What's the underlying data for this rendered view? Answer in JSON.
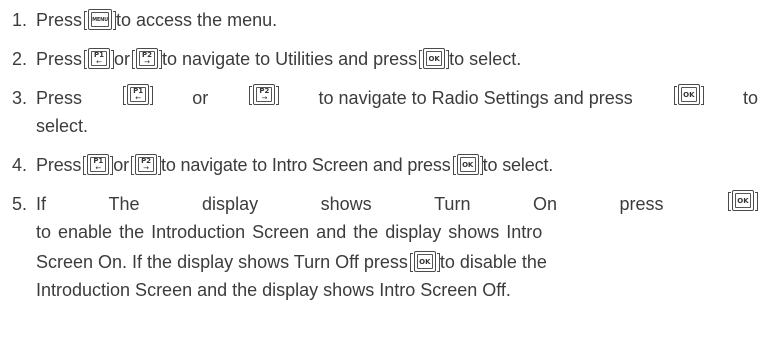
{
  "steps": [
    {
      "number": "1.",
      "lines": [
        [
          "Press",
          {
            "key": "MENU"
          },
          "to access the menu."
        ]
      ]
    },
    {
      "number": "2.",
      "lines": [
        [
          "Press",
          {
            "key": "P1"
          },
          "or",
          {
            "key": "P2"
          },
          "to navigate to Utilities and press",
          {
            "key": "OK"
          },
          "to select."
        ]
      ]
    },
    {
      "number": "3.",
      "lines": [
        [
          "Press",
          {
            "key": "P1"
          },
          "or",
          {
            "key": "P2"
          },
          "to navigate to Radio Settings and press",
          {
            "key": "OK"
          },
          "to"
        ],
        [
          "select."
        ]
      ]
    },
    {
      "number": "4.",
      "lines": [
        [
          "Press",
          {
            "key": "P1"
          },
          "or",
          {
            "key": "P2"
          },
          "to navigate to Intro Screen and press",
          {
            "key": "OK"
          },
          "to select."
        ]
      ]
    },
    {
      "number": "5.",
      "lines": [
        [
          "If",
          "The",
          "display",
          "shows",
          "Turn",
          "On",
          "press",
          {
            "key": "OK"
          }
        ],
        [
          "to enable the Introduction Screen and the display shows Intro"
        ],
        [
          "Screen On. If the display shows Turn Off press",
          {
            "key": "OK"
          },
          "to disable the"
        ],
        [
          "Introduction Screen and the display shows Intro Screen Off."
        ]
      ]
    }
  ],
  "keys": {
    "MENU": {
      "label": "MENU"
    },
    "OK": {
      "label": "OK"
    },
    "P1": {
      "label": "P1",
      "arrow": "←"
    },
    "P2": {
      "label": "P2",
      "arrow": "→"
    }
  }
}
